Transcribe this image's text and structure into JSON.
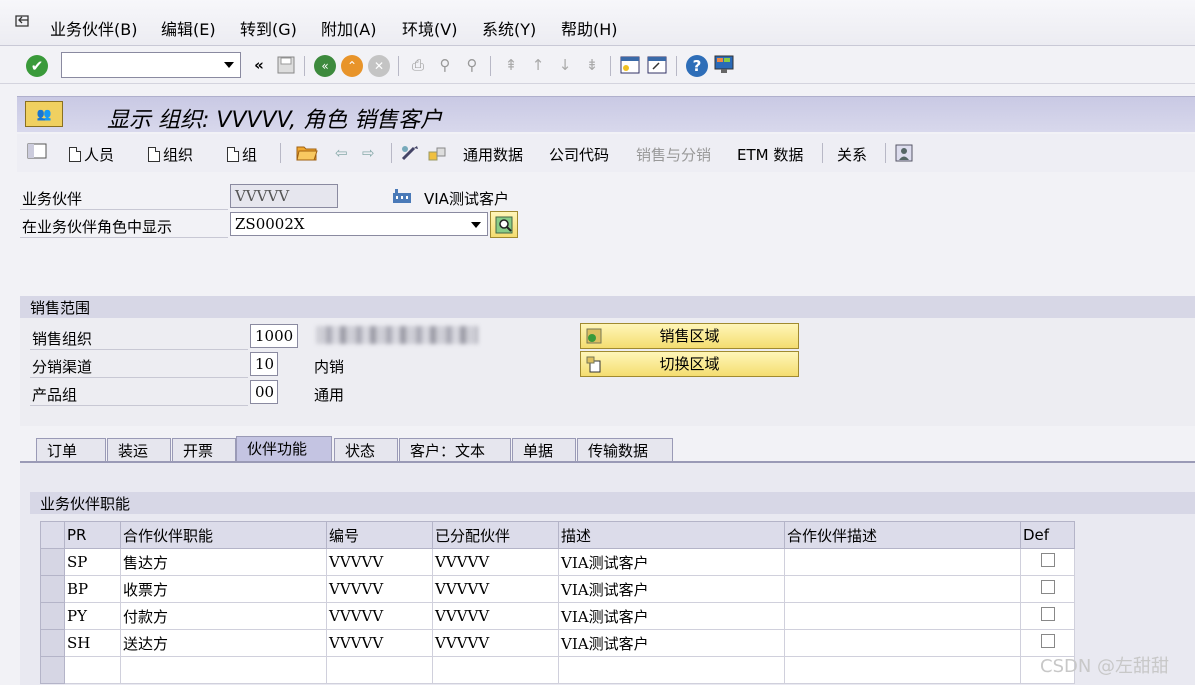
{
  "menu": {
    "items": [
      "业务伙伴(B)",
      "编辑(E)",
      "转到(G)",
      "附加(A)",
      "环境(V)",
      "系统(Y)",
      "帮助(H)"
    ]
  },
  "command_field": {
    "value": ""
  },
  "title": "显示 组织: VVVVV, 角色 销售客户",
  "toolbar2": {
    "person": "人员",
    "org": "组织",
    "group": "组",
    "general_data": "通用数据",
    "company_code": "公司代码",
    "sales_distribution": "销售与分销",
    "etm_data": "ETM 数据",
    "relations": "关系"
  },
  "header": {
    "bp_label": "业务伙伴",
    "bp_value": "VVVVV",
    "bp_desc": "VIA测试客户",
    "role_label": "在业务伙伴角色中显示",
    "role_value": "ZS0002X"
  },
  "sales_area": {
    "title": "销售范围",
    "sales_org_label": "销售组织",
    "sales_org_value": "1000",
    "channel_label": "分销渠道",
    "channel_value": "10",
    "channel_desc": "内销",
    "division_label": "产品组",
    "division_value": "00",
    "division_desc": "通用",
    "btn_sales_area": "销售区域",
    "btn_switch_area": "切换区域"
  },
  "tabs": [
    "订单",
    "装运",
    "开票",
    "伙伴功能",
    "状态",
    "客户：文本",
    "单据",
    "传输数据"
  ],
  "active_tab": "伙伴功能",
  "partner_functions": {
    "title": "业务伙伴职能",
    "columns": [
      "PR",
      "合作伙伴职能",
      "编号",
      "已分配伙伴",
      "描述",
      "合作伙伴描述",
      "Def"
    ],
    "rows": [
      {
        "pr": "SP",
        "func": "售达方",
        "num": "VVVVV",
        "assigned": "VVVVV",
        "desc": "VIA测试客户",
        "pdesc": ""
      },
      {
        "pr": "BP",
        "func": "收票方",
        "num": "VVVVV",
        "assigned": "VVVVV",
        "desc": "VIA测试客户",
        "pdesc": ""
      },
      {
        "pr": "PY",
        "func": "付款方",
        "num": "VVVVV",
        "assigned": "VVVVV",
        "desc": "VIA测试客户",
        "pdesc": ""
      },
      {
        "pr": "SH",
        "func": "送达方",
        "num": "VVVVV",
        "assigned": "VVVVV",
        "desc": "VIA测试客户",
        "pdesc": ""
      }
    ]
  },
  "watermark": "CSDN @左甜甜",
  "colors": {
    "title_bg": "#c9c9e4",
    "button_bg": "#f4dd70",
    "tab_active": "#c4c4e2"
  }
}
